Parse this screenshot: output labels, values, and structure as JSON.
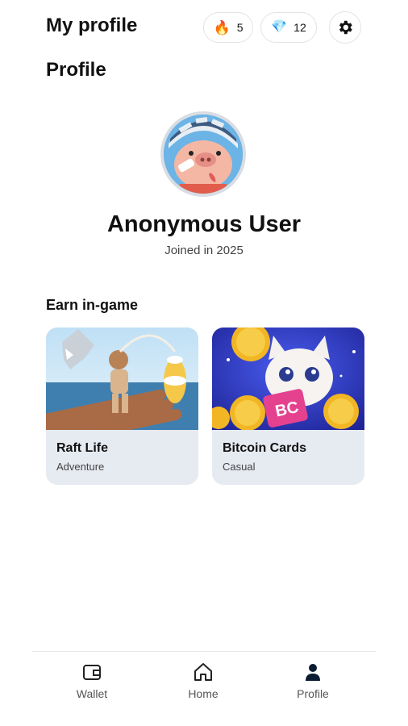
{
  "header": {
    "title": "My profile",
    "streak_count": "5",
    "gem_count": "12",
    "streak_icon": "fire-icon",
    "gem_icon": "diamond-icon",
    "settings_icon": "gear-icon"
  },
  "profile": {
    "section_title": "Profile",
    "name": "Anonymous User",
    "joined": "Joined in 2025",
    "avatar_icon": "pig-avatar"
  },
  "earn": {
    "title": "Earn in-game",
    "games": [
      {
        "name": "Raft Life",
        "genre": "Adventure"
      },
      {
        "name": "Bitcoin Cards",
        "genre": "Casual"
      }
    ]
  },
  "nav": {
    "items": [
      {
        "label": "Wallet",
        "icon": "wallet-icon"
      },
      {
        "label": "Home",
        "icon": "home-icon"
      },
      {
        "label": "Profile",
        "icon": "user-icon"
      }
    ],
    "active": "Profile"
  },
  "colors": {
    "card_bg": "#e6eaf1",
    "active_nav": "#0b1b33"
  }
}
